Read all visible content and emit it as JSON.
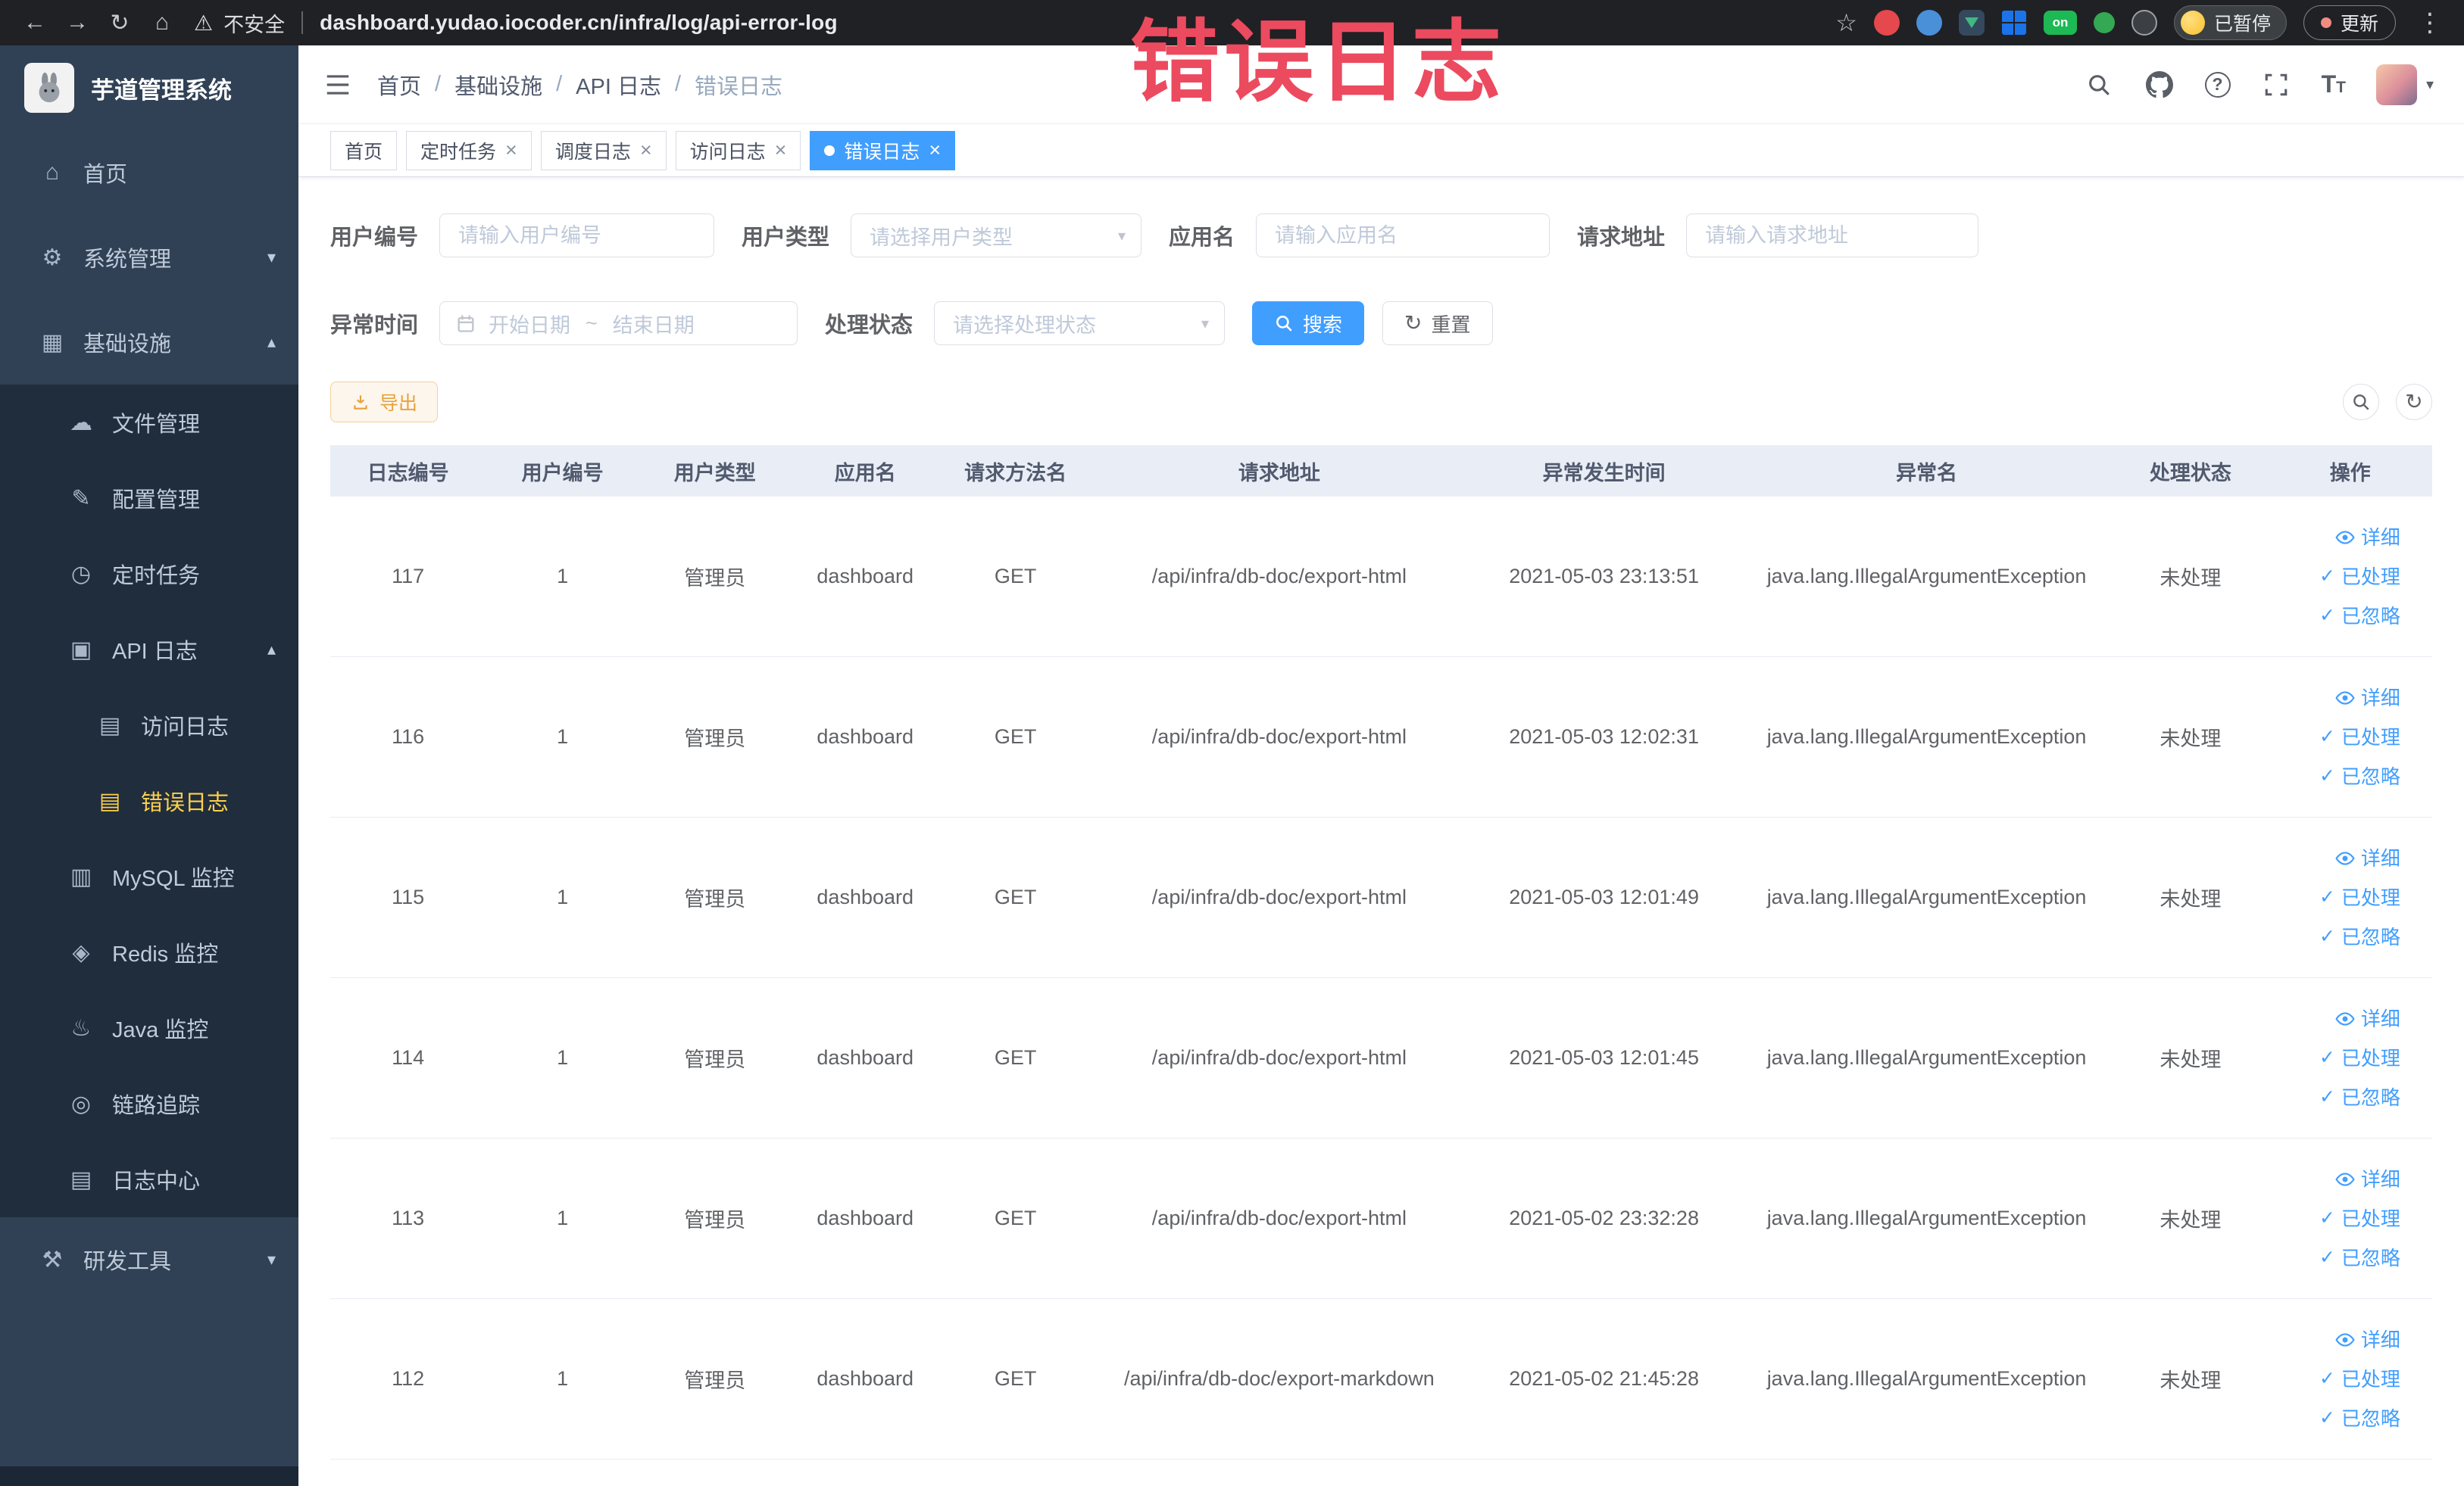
{
  "browser": {
    "security_label": "不安全",
    "url": "dashboard.yudao.iocoder.cn/infra/log/api-error-log",
    "ext_badge": "on",
    "paused_label": "已暂停",
    "update_label": "更新"
  },
  "annotation": "错误日志",
  "sidebar": {
    "title": "芋道管理系统",
    "items": [
      {
        "label": "首页"
      },
      {
        "label": "系统管理"
      },
      {
        "label": "基础设施"
      },
      {
        "label": "文件管理"
      },
      {
        "label": "配置管理"
      },
      {
        "label": "定时任务"
      },
      {
        "label": "API 日志"
      },
      {
        "label": "访问日志"
      },
      {
        "label": "错误日志"
      },
      {
        "label": "MySQL 监控"
      },
      {
        "label": "Redis 监控"
      },
      {
        "label": "Java 监控"
      },
      {
        "label": "链路追踪"
      },
      {
        "label": "日志中心"
      },
      {
        "label": "研发工具"
      }
    ]
  },
  "header": {
    "breadcrumb": [
      "首页",
      "基础设施",
      "API 日志",
      "错误日志"
    ]
  },
  "tabs": [
    {
      "label": "首页"
    },
    {
      "label": "定时任务"
    },
    {
      "label": "调度日志"
    },
    {
      "label": "访问日志"
    },
    {
      "label": "错误日志"
    }
  ],
  "filters": {
    "user_id": {
      "label": "用户编号",
      "placeholder": "请输入用户编号"
    },
    "user_type": {
      "label": "用户类型",
      "placeholder": "请选择用户类型"
    },
    "app_name": {
      "label": "应用名",
      "placeholder": "请输入应用名"
    },
    "request_url": {
      "label": "请求地址",
      "placeholder": "请输入请求地址"
    },
    "exception_time": {
      "label": "异常时间",
      "start_placeholder": "开始日期",
      "separator": "~",
      "end_placeholder": "结束日期"
    },
    "process_status": {
      "label": "处理状态",
      "placeholder": "请选择处理状态"
    },
    "search_label": "搜索",
    "reset_label": "重置"
  },
  "toolbar": {
    "export_label": "导出"
  },
  "table": {
    "columns": [
      "日志编号",
      "用户编号",
      "用户类型",
      "应用名",
      "请求方法名",
      "请求地址",
      "异常发生时间",
      "异常名",
      "处理状态",
      "操作"
    ],
    "actions": {
      "detail": "详细",
      "processed": "已处理",
      "ignored": "已忽略"
    },
    "rows": [
      {
        "id": "117",
        "user_id": "1",
        "user_type": "管理员",
        "app": "dashboard",
        "method": "GET",
        "url": "/api/infra/db-doc/export-html",
        "time": "2021-05-03 23:13:51",
        "exception": "java.lang.IllegalArgumentException",
        "status": "未处理"
      },
      {
        "id": "116",
        "user_id": "1",
        "user_type": "管理员",
        "app": "dashboard",
        "method": "GET",
        "url": "/api/infra/db-doc/export-html",
        "time": "2021-05-03 12:02:31",
        "exception": "java.lang.IllegalArgumentException",
        "status": "未处理"
      },
      {
        "id": "115",
        "user_id": "1",
        "user_type": "管理员",
        "app": "dashboard",
        "method": "GET",
        "url": "/api/infra/db-doc/export-html",
        "time": "2021-05-03 12:01:49",
        "exception": "java.lang.IllegalArgumentException",
        "status": "未处理"
      },
      {
        "id": "114",
        "user_id": "1",
        "user_type": "管理员",
        "app": "dashboard",
        "method": "GET",
        "url": "/api/infra/db-doc/export-html",
        "time": "2021-05-03 12:01:45",
        "exception": "java.lang.IllegalArgumentException",
        "status": "未处理"
      },
      {
        "id": "113",
        "user_id": "1",
        "user_type": "管理员",
        "app": "dashboard",
        "method": "GET",
        "url": "/api/infra/db-doc/export-html",
        "time": "2021-05-02 23:32:28",
        "exception": "java.lang.IllegalArgumentException",
        "status": "未处理"
      },
      {
        "id": "112",
        "user_id": "1",
        "user_type": "管理员",
        "app": "dashboard",
        "method": "GET",
        "url": "/api/infra/db-doc/export-markdown",
        "time": "2021-05-02 21:45:28",
        "exception": "java.lang.IllegalArgumentException",
        "status": "未处理"
      }
    ]
  }
}
